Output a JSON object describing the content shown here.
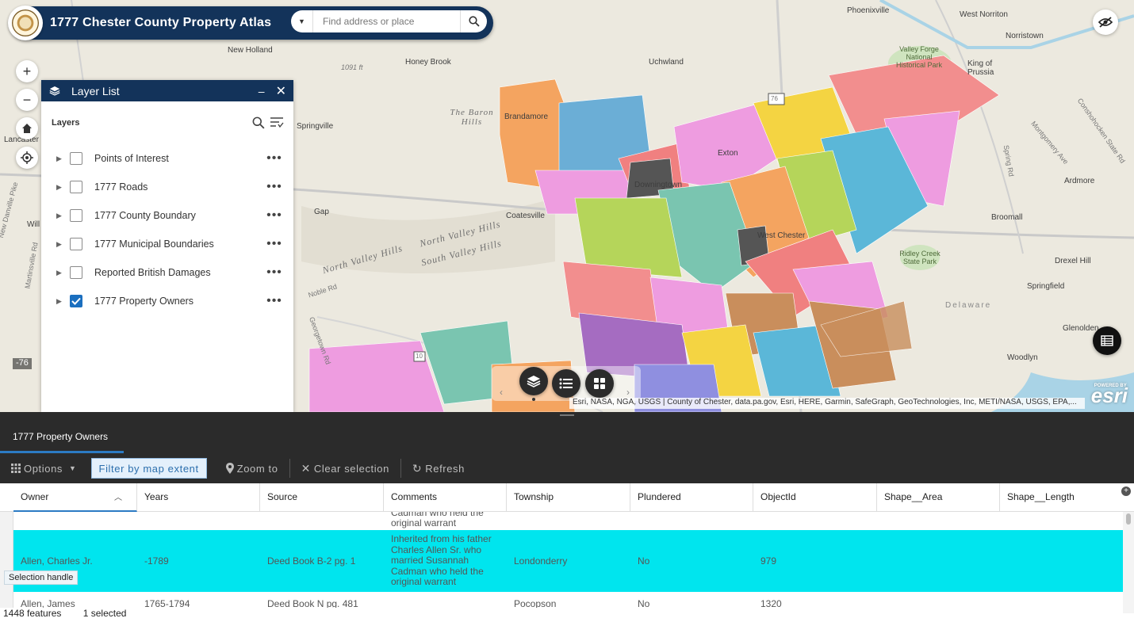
{
  "header": {
    "title": "1777 Chester County Property Atlas",
    "search_placeholder": "Find address or place"
  },
  "map": {
    "places": [
      "Phoenixville",
      "West Norriton",
      "Norristown",
      "New Holland",
      "Honey Brook",
      "Uchwland",
      "Valley Forge National Historical Park",
      "King of Prussia",
      "The Baron Hills",
      "Brandamore",
      "Springville",
      "Exton",
      "Downingtown",
      "Coatesville",
      "Gap",
      "North Valley Hills",
      "South Valley Hills",
      "Broomall",
      "Ridley Creek State Park",
      "Drexel Hill",
      "Springfield",
      "Ardmore",
      "Delaware",
      "Glenolden",
      "Woodlyn",
      "West Chester",
      "Lancaster",
      "Will"
    ],
    "roads": [
      "Spring Rd",
      "Montgomery Ave",
      "Conshohocken State Rd",
      "Noble Rd",
      "Georgetown Rd",
      "Martinsville Rd",
      "New Danville Pike"
    ],
    "elevation_label": "1091 ft",
    "shield_76": "76",
    "shield_10": "10",
    "coordinate_readout": "-76",
    "attribution": "Esri, NASA, NGA, USGS | County of Chester, data.pa.gov, Esri, HERE, Garmin, SafeGraph, GeoTechnologies, Inc, METI/NASA, USGS, EPA,...",
    "esri_logo": "esri",
    "esri_powered": "POWERED BY",
    "township_colors": [
      "#f4a460",
      "#6baed6",
      "#f28e8e",
      "#f4c542",
      "#b5d55a",
      "#e58ec8",
      "#7ac5b0",
      "#a56cc1",
      "#c98e5c",
      "#f08080",
      "#ee9ce0",
      "#5bb7d8"
    ]
  },
  "layer_list": {
    "title": "Layer List",
    "section_label": "Layers",
    "layers": [
      {
        "name": "Points of Interest",
        "checked": false
      },
      {
        "name": "1777 Roads",
        "checked": false
      },
      {
        "name": "1777 County Boundary",
        "checked": false
      },
      {
        "name": "1777 Municipal Boundaries",
        "checked": false
      },
      {
        "name": "Reported British Damages",
        "checked": false
      },
      {
        "name": "1777 Property Owners",
        "checked": true
      }
    ]
  },
  "table": {
    "tab_label": "1777 Property Owners",
    "toolbar": {
      "options": "Options",
      "filter": "Filter by map extent",
      "zoom_to": "Zoom to",
      "clear_selection": "Clear selection",
      "refresh": "Refresh"
    },
    "columns": [
      "Owner",
      "Years",
      "Source",
      "Comments",
      "Township",
      "Plundered",
      "ObjectId",
      "Shape__Area",
      "Shape__Length"
    ],
    "partial_row_comment": "original warrant",
    "partial_row_comment_top": "Cadman who held the",
    "rows": [
      {
        "owner": "Allen, Charles Jr.",
        "years": "-1789",
        "source": "Deed Book B-2 pg. 1",
        "comments": "Inherited from his father Charles Allen Sr. who married Susannah Cadman who held the original warrant",
        "township": "Londonderry",
        "plundered": "No",
        "objectid": "979"
      },
      {
        "owner": "Allen, James",
        "years": "1765-1794",
        "source": "Deed Book N pg. 481",
        "comments": "",
        "township": "Pocopson",
        "plundered": "No",
        "objectid": "1320"
      }
    ],
    "selection_tooltip": "Selection handle",
    "feature_count": "1448 features",
    "selected_count": "1 selected"
  }
}
